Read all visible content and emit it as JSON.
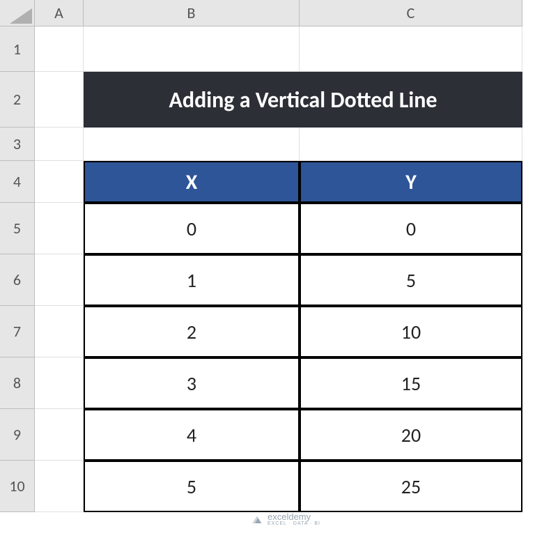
{
  "columns": [
    "A",
    "B",
    "C"
  ],
  "rows": [
    "1",
    "2",
    "3",
    "4",
    "5",
    "6",
    "7",
    "8",
    "9",
    "10"
  ],
  "title": "Adding a Vertical Dotted Line",
  "table": {
    "headers": {
      "x": "X",
      "y": "Y"
    },
    "data": [
      {
        "x": "0",
        "y": "0"
      },
      {
        "x": "1",
        "y": "5"
      },
      {
        "x": "2",
        "y": "10"
      },
      {
        "x": "3",
        "y": "15"
      },
      {
        "x": "4",
        "y": "20"
      },
      {
        "x": "5",
        "y": "25"
      }
    ]
  },
  "watermark": {
    "brand": "exceldemy",
    "tagline": "EXCEL · DATA · BI"
  }
}
